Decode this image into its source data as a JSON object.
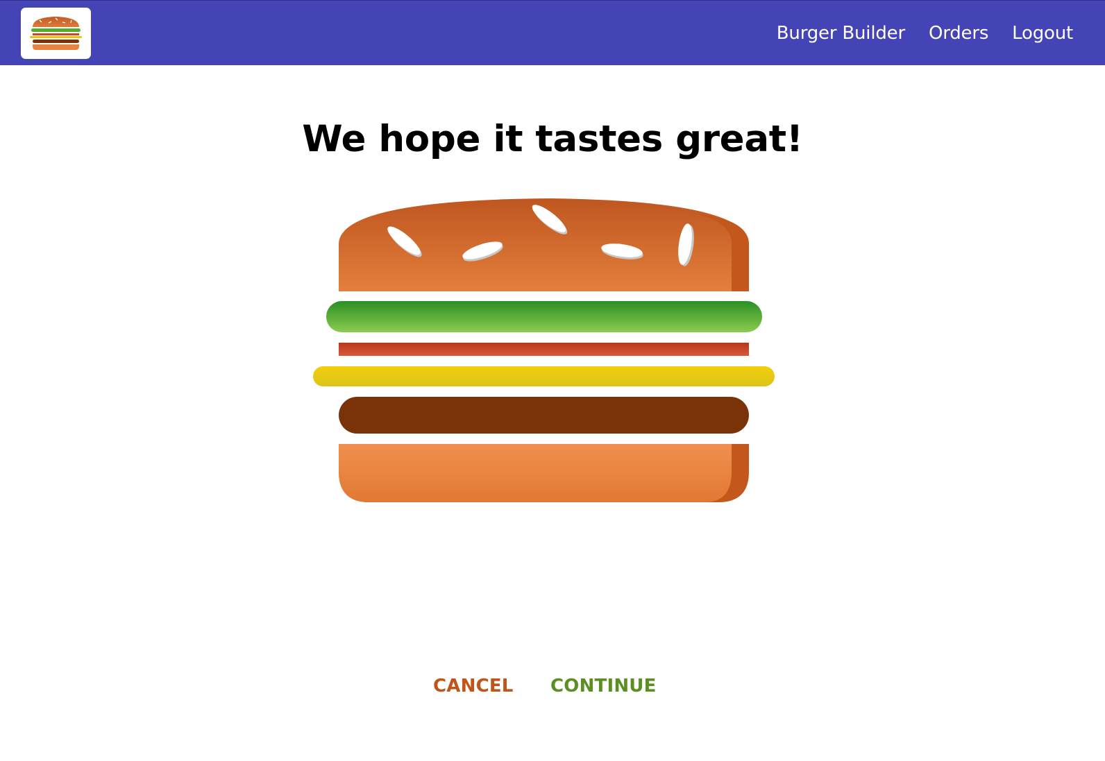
{
  "nav": {
    "logo_icon": "burger-logo-icon",
    "items": [
      {
        "label": "Burger Builder"
      },
      {
        "label": "Orders"
      },
      {
        "label": "Logout"
      }
    ],
    "background": "#4444b6"
  },
  "summary": {
    "heading": "We hope it tastes great!"
  },
  "burger": {
    "ingredients": [
      "salad",
      "bacon",
      "cheese",
      "meat"
    ],
    "colors": {
      "bun": "#e07b3a",
      "salad": "#4caf2e",
      "bacon": "#c44a20",
      "cheese": "#e8c414",
      "meat": "#7a3208"
    }
  },
  "actions": {
    "cancel_label": "CANCEL",
    "continue_label": "CONTINUE",
    "cancel_color": "#c0551a",
    "continue_color": "#5b8f22"
  }
}
